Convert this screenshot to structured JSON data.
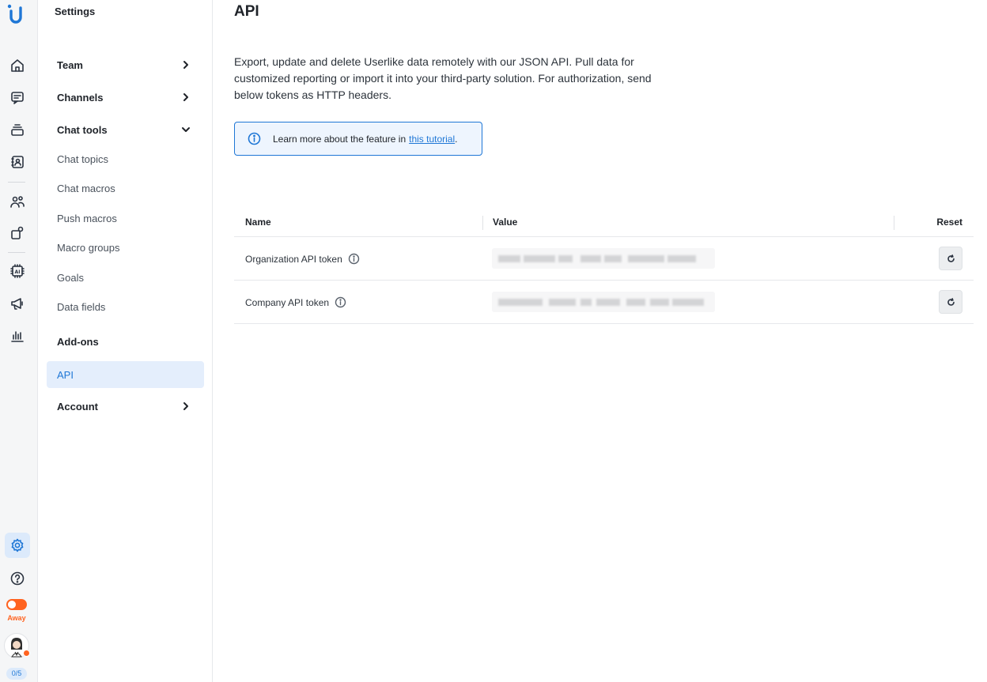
{
  "rail": {
    "presence_label": "Away",
    "chat_count": "0/5",
    "accent": "#1f77d6",
    "status_color": "#ff6320"
  },
  "sidebar": {
    "title": "Settings",
    "items": [
      {
        "label": "Team",
        "type": "group",
        "expander": "chevron-right"
      },
      {
        "label": "Channels",
        "type": "group",
        "expander": "chevron-right"
      },
      {
        "label": "Chat tools",
        "type": "group",
        "expander": "chevron-down"
      },
      {
        "label": "Chat topics",
        "type": "sub"
      },
      {
        "label": "Chat macros",
        "type": "sub"
      },
      {
        "label": "Push macros",
        "type": "sub"
      },
      {
        "label": "Macro groups",
        "type": "sub"
      },
      {
        "label": "Goals",
        "type": "sub"
      },
      {
        "label": "Data fields",
        "type": "sub"
      },
      {
        "label": "Add-ons",
        "type": "group"
      },
      {
        "label": "API",
        "type": "sub",
        "active": true
      },
      {
        "label": "Account",
        "type": "group",
        "expander": "chevron-right"
      }
    ]
  },
  "main": {
    "title": "API",
    "intro": "Export, update and delete Userlike data remotely with our JSON API. Pull data for customized reporting or import it into your third-party solution. For authorization, send below tokens as HTTP headers.",
    "info_box": {
      "text": "Learn more about the feature in",
      "link_text": "this tutorial",
      "suffix": "."
    },
    "table": {
      "headers": [
        "Name",
        "Value",
        "Reset"
      ],
      "rows": [
        {
          "name": "Organization API token",
          "value_state": "blurred"
        },
        {
          "name": "Company API token",
          "value_state": "blurred"
        }
      ]
    }
  }
}
